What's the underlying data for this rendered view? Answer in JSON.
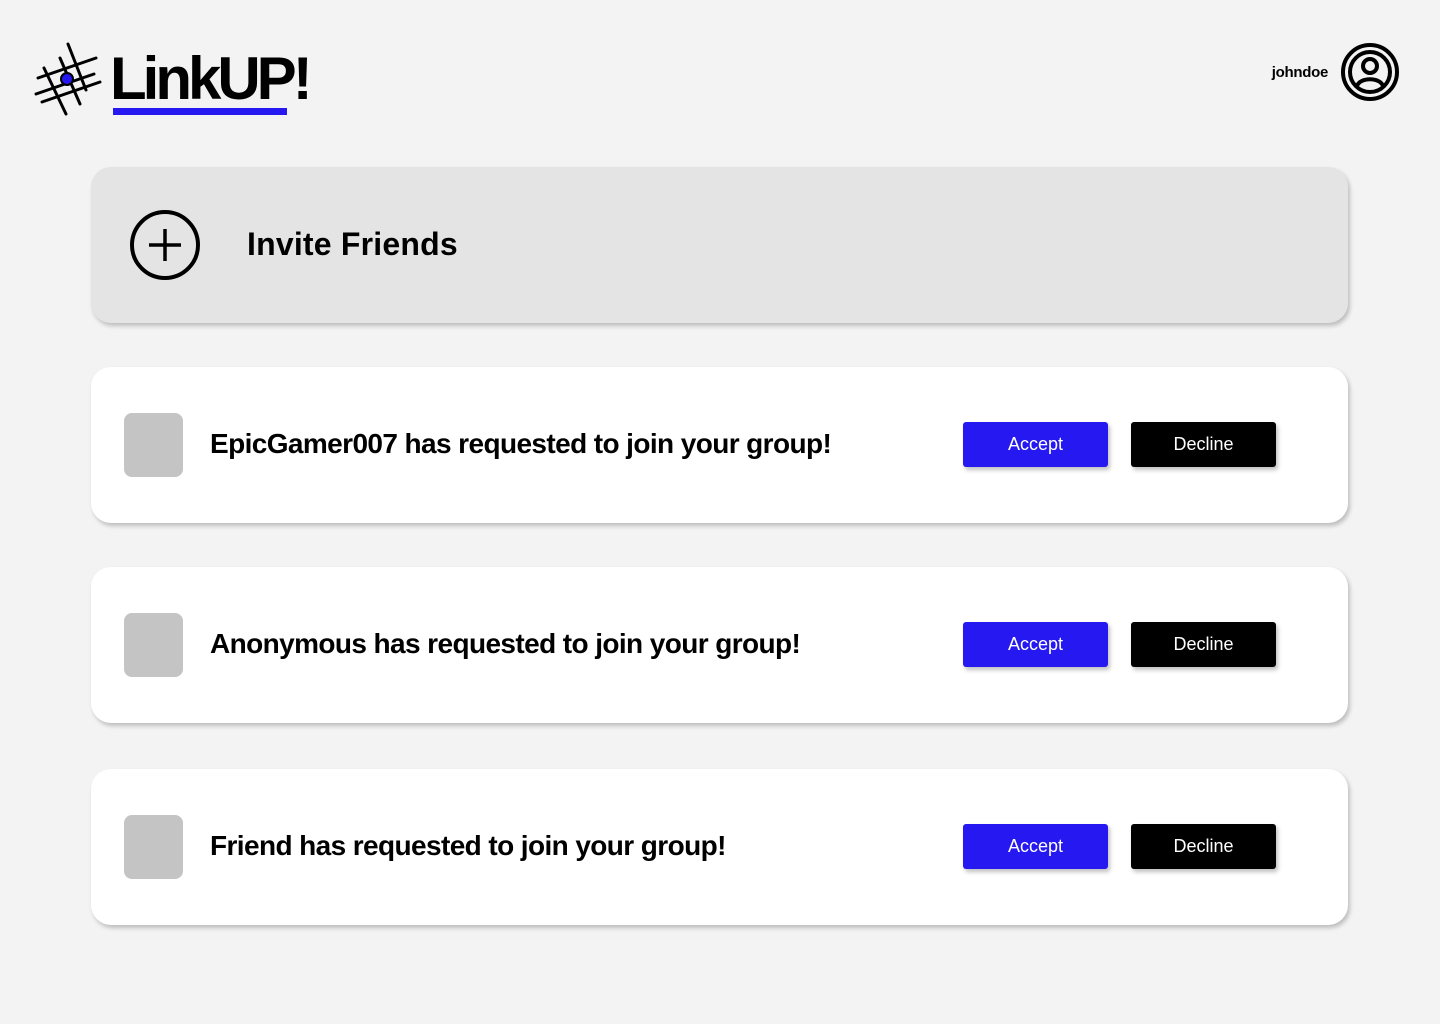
{
  "header": {
    "brand": "LinkUP!",
    "username": "johndoe"
  },
  "invite": {
    "label": "Invite Friends"
  },
  "requests": [
    {
      "message": "EpicGamer007 has requested to join your group!",
      "accept_label": "Accept",
      "decline_label": "Decline"
    },
    {
      "message": "Anonymous has requested to join your group!",
      "accept_label": "Accept",
      "decline_label": "Decline"
    },
    {
      "message": "Friend has requested to join your group!",
      "accept_label": "Accept",
      "decline_label": "Decline"
    }
  ],
  "colors": {
    "accent": "#2618f0",
    "background": "#f3f3f3",
    "invite_card": "#e4e4e4",
    "avatar_placeholder": "#c4c4c4"
  },
  "icons": {
    "logo": "linkup-logo-icon",
    "profile": "user-circle-icon",
    "invite": "plus-circle-icon"
  }
}
